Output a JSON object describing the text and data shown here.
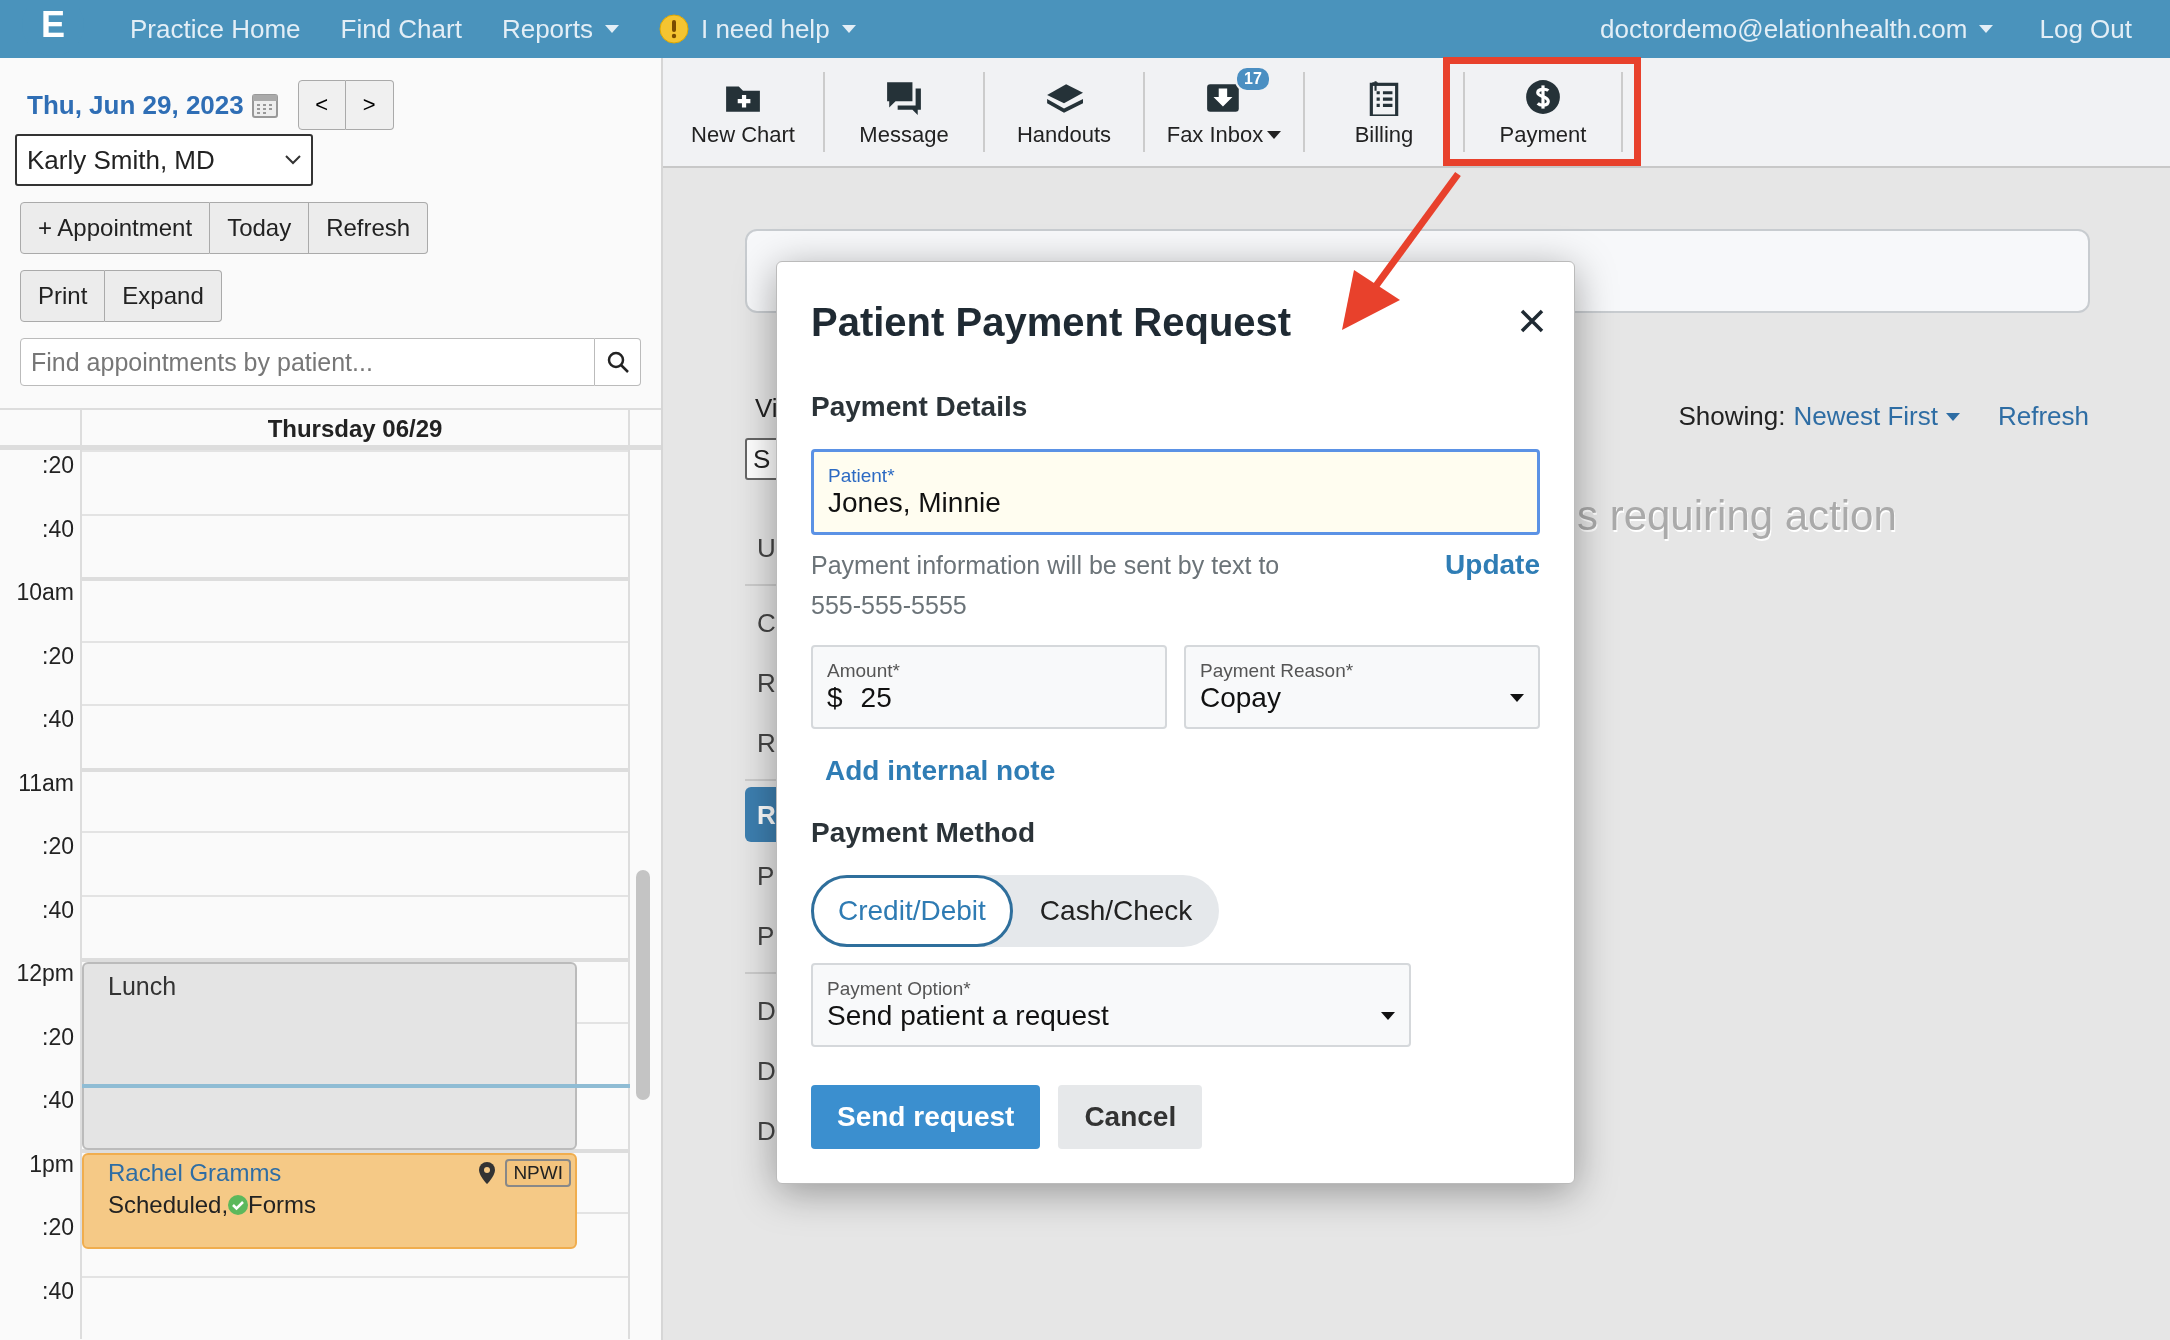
{
  "nav": {
    "logo": "E",
    "items": [
      {
        "label": "Practice Home",
        "has_menu": false,
        "alert": false
      },
      {
        "label": "Find Chart",
        "has_menu": false,
        "alert": false
      },
      {
        "label": "Reports",
        "has_menu": true,
        "alert": false
      },
      {
        "label": "I need help",
        "has_menu": true,
        "alert": true
      }
    ],
    "user": {
      "label": "doctordemo@elationhealth.com",
      "has_menu": true
    },
    "logout": "Log Out"
  },
  "schedule": {
    "date": "Thu, Jun 29, 2023",
    "prev": "<",
    "next": ">",
    "provider": "Karly Smith, MD",
    "action_rows": [
      {
        "buttons": [
          "+ Appointment",
          "Today",
          "Refresh"
        ]
      },
      {
        "buttons": [
          "Print",
          "Expand"
        ]
      }
    ],
    "search": {
      "placeholder": "Find appointments by patient..."
    },
    "day_header": "Thursday 06/29",
    "rows": [
      {
        "time": ":20",
        "kind": "minute"
      },
      {
        "time": ":40",
        "kind": "minute"
      },
      {
        "time": "10am",
        "kind": "hour"
      },
      {
        "time": ":20",
        "kind": "minute"
      },
      {
        "time": ":40",
        "kind": "minute"
      },
      {
        "time": "11am",
        "kind": "hour"
      },
      {
        "time": ":20",
        "kind": "minute"
      },
      {
        "time": ":40",
        "kind": "minute"
      },
      {
        "time": "12pm",
        "kind": "hour",
        "event": {
          "kind": "block",
          "title": "Lunch"
        }
      },
      {
        "time": ":20",
        "kind": "minute"
      },
      {
        "time": ":40",
        "kind": "minute",
        "current_time": true
      },
      {
        "time": "1pm",
        "kind": "hour",
        "event": {
          "kind": "appointment",
          "title": "Rachel Gramms",
          "status": "Scheduled, ",
          "forms": "Forms",
          "tag": "NPWI"
        }
      },
      {
        "time": ":20",
        "kind": "minute"
      },
      {
        "time": ":40",
        "kind": "minute"
      }
    ]
  },
  "toolbar": {
    "items": [
      {
        "label": "New Chart",
        "has_menu": false,
        "highlighted": false
      },
      {
        "label": "Message",
        "has_menu": false,
        "highlighted": false
      },
      {
        "label": "Handouts",
        "has_menu": false,
        "highlighted": false
      },
      {
        "label": "Fax Inbox",
        "has_menu": true,
        "highlighted": false,
        "badge": "17"
      },
      {
        "label": "Billing",
        "has_menu": false,
        "highlighted": false
      },
      {
        "label": "Payment",
        "has_menu": false,
        "highlighted": true
      }
    ]
  },
  "main": {
    "side_label": "Vi",
    "side_select": "S",
    "side_groups": [
      {
        "items": [
          {
            "text": "U",
            "selected": false
          }
        ]
      },
      {
        "items": [
          {
            "text": "C",
            "selected": false
          },
          {
            "text": "R",
            "selected": false
          },
          {
            "text": "R",
            "selected": false
          }
        ]
      },
      {
        "items": [
          {
            "text": "R",
            "selected": true
          },
          {
            "text": "P",
            "selected": false
          },
          {
            "text": "P",
            "selected": false
          }
        ]
      },
      {
        "items": [
          {
            "text": "D",
            "selected": false
          },
          {
            "text": "D",
            "selected": false
          },
          {
            "text": "D",
            "selected": false
          }
        ]
      }
    ],
    "filter": {
      "prefix": "Showing:",
      "value": "Newest First"
    },
    "refresh": "Refresh",
    "empty_text": "s requiring action"
  },
  "modal": {
    "title": "Patient Payment Request",
    "details_heading": "Payment Details",
    "patient": {
      "label": "Patient*",
      "value": "Jones, Minnie",
      "focused": true
    },
    "help_text": "Payment information will be sent by text to 555-555-5555",
    "update_link": "Update",
    "amount": {
      "label": "Amount*",
      "currency": "$",
      "value": "25"
    },
    "reason": {
      "label": "Payment Reason*",
      "value": "Copay"
    },
    "note_link": "Add internal note",
    "method_heading": "Payment Method",
    "methods": [
      {
        "label": "Credit/Debit",
        "selected": true
      },
      {
        "label": "Cash/Check",
        "selected": false
      }
    ],
    "option": {
      "label": "Payment Option*",
      "value": "Send patient a request"
    },
    "buttons": [
      {
        "label": "Send request",
        "kind": "primary"
      },
      {
        "label": "Cancel",
        "kind": "secondary"
      }
    ]
  }
}
